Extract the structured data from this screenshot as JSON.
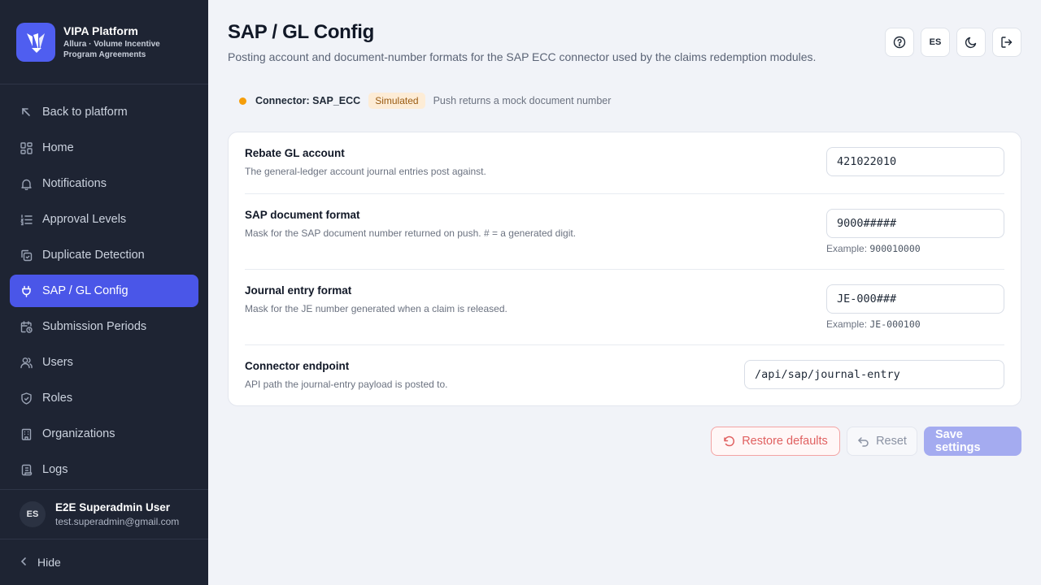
{
  "sidebar": {
    "brand_title": "VIPA Platform",
    "brand_subtitle": "Allura · Volume Incentive Program Agreements",
    "items": [
      {
        "label": "Back to platform",
        "icon": "arrow-up-left-icon"
      },
      {
        "label": "Home",
        "icon": "dashboard-icon"
      },
      {
        "label": "Notifications",
        "icon": "bell-icon"
      },
      {
        "label": "Approval Levels",
        "icon": "list-ordered-icon"
      },
      {
        "label": "Duplicate Detection",
        "icon": "copy-check-icon"
      },
      {
        "label": "SAP / GL Config",
        "icon": "plug-icon",
        "active": true
      },
      {
        "label": "Submission Periods",
        "icon": "calendar-clock-icon"
      },
      {
        "label": "Users",
        "icon": "users-icon"
      },
      {
        "label": "Roles",
        "icon": "shield-check-icon"
      },
      {
        "label": "Organizations",
        "icon": "building-icon"
      },
      {
        "label": "Logs",
        "icon": "scroll-icon"
      }
    ],
    "user": {
      "initials": "ES",
      "name": "E2E Superadmin User",
      "email": "test.superadmin@gmail.com"
    },
    "hide_label": "Hide"
  },
  "header": {
    "title": "SAP / GL Config",
    "description": "Posting account and document-number formats for the SAP ECC connector used by the claims redemption modules.",
    "language_code": "ES"
  },
  "connector": {
    "label": "Connector: SAP_ECC",
    "badge": "Simulated",
    "note": "Push returns a mock document number",
    "status_color": "#f59e0b"
  },
  "settings": [
    {
      "title": "Rebate GL account",
      "help": "The general-ledger account journal entries post against.",
      "value": "421022010"
    },
    {
      "title": "SAP document format",
      "help": "Mask for the SAP document number returned on push. # = a generated digit.",
      "value": "9000#####",
      "example_label": "Example:",
      "example_value": "900010000"
    },
    {
      "title": "Journal entry format",
      "help": "Mask for the JE number generated when a claim is released.",
      "value": "JE-000###",
      "example_label": "Example:",
      "example_value": "JE-000100"
    },
    {
      "title": "Connector endpoint",
      "help": "API path the journal-entry payload is posted to.",
      "value": "/api/sap/journal-entry"
    }
  ],
  "actions": {
    "restore_label": "Restore defaults",
    "reset_label": "Reset",
    "save_label": "Save settings"
  },
  "colors": {
    "accent": "#4a56e8",
    "sidebar_bg": "#1e2433",
    "save_disabled": "#a4abf0",
    "restore": "#e06060"
  }
}
